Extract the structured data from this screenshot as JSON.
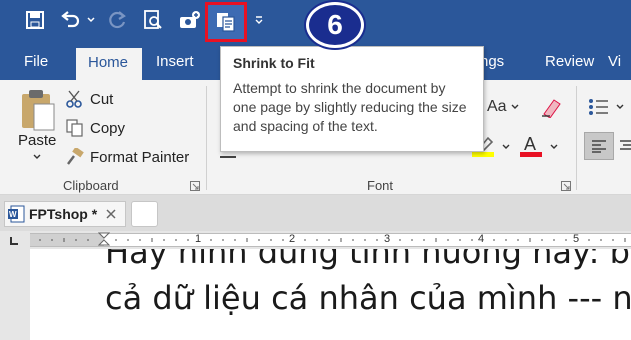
{
  "quick_access": {
    "save_icon": "save-icon",
    "undo_icon": "undo-icon",
    "redo_icon": "redo-icon",
    "print_preview_icon": "print-preview-icon",
    "camera_icon": "camera-icon",
    "shrink_icon": "shrink-to-fit-icon",
    "customize_icon": "customize-qat-icon"
  },
  "step_badge": "6",
  "tabs": [
    {
      "label": "File"
    },
    {
      "label": "Home"
    },
    {
      "label": "Insert"
    },
    {
      "label": "ilings"
    },
    {
      "label": "Review"
    },
    {
      "label": "Vi"
    }
  ],
  "tooltip": {
    "title": "Shrink to Fit",
    "body": "Attempt to shrink the document by one page by slightly reducing the size and spacing of the text."
  },
  "clipboard": {
    "paste_label": "Paste",
    "cut_label": "Cut",
    "copy_label": "Copy",
    "format_painter_label": "Format Painter",
    "group_label": "Clipboard"
  },
  "font_group": {
    "group_label": "Font",
    "aa_label": "Aa",
    "font_color_label": "A"
  },
  "doc_tab": {
    "name": "FPTshop *"
  },
  "ruler": {
    "numbers": [
      "1",
      "2",
      "3",
      "4",
      "5"
    ]
  },
  "document": {
    "line1": "Hãy hình dung tình huống này: b",
    "line2": "cả dữ liệu cá nhân của mình --- n"
  },
  "colors": {
    "ribbon_blue": "#2b579a",
    "highlight_yellow": "#ffff00",
    "font_red": "#e81123",
    "badge_blue": "#1a2d8f",
    "outline_red": "#e81123"
  }
}
